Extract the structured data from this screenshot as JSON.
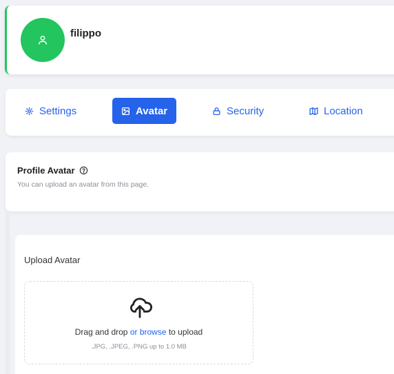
{
  "profile": {
    "username": "filippo",
    "avatar_color": "#22c55e",
    "avatar_icon": "user-icon"
  },
  "tabs": [
    {
      "label": "Settings",
      "icon": "gear-icon",
      "active": false
    },
    {
      "label": "Avatar",
      "icon": "image-icon",
      "active": true
    },
    {
      "label": "Security",
      "icon": "lock-icon",
      "active": false
    },
    {
      "label": "Location",
      "icon": "map-icon",
      "active": false
    }
  ],
  "avatar_section": {
    "title": "Profile Avatar",
    "help_icon": "question-circle-icon",
    "subtitle": "You can upload an avatar from this page."
  },
  "upload": {
    "title": "Upload Avatar",
    "icon": "cloud-upload-icon",
    "drag_text": "Drag and drop",
    "browse_text": "or browse",
    "upload_text": "to upload",
    "hint": ".JPG, .JPEG, .PNG up to 1.0 MB"
  },
  "colors": {
    "accent": "#2563eb",
    "success": "#22c55e"
  }
}
